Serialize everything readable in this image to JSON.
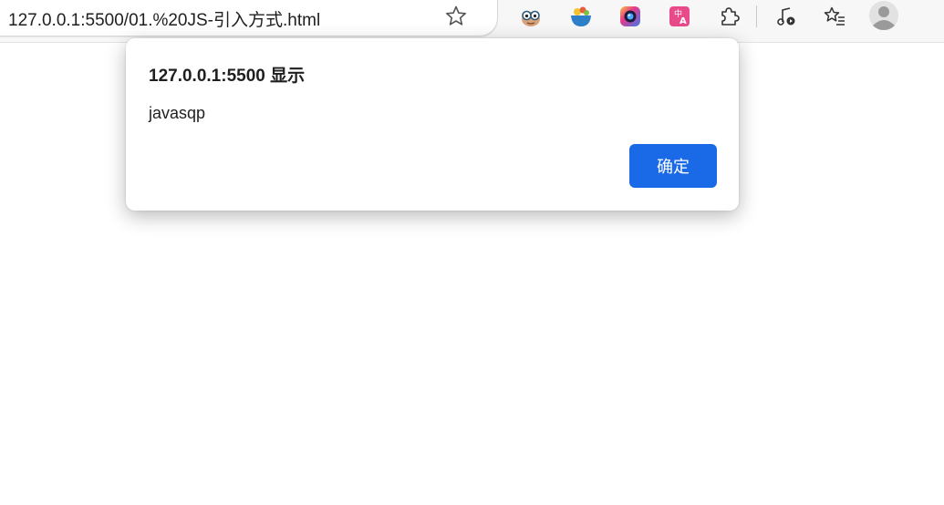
{
  "browser": {
    "url": "127.0.0.1:5500/01.%20JS-引入方式.html",
    "icons": [
      "favorite-star-icon",
      "extension-eyes-icon",
      "extension-bowl-icon",
      "extension-camera-icon",
      "translate-icon",
      "extensions-puzzle-icon",
      "media-music-icon",
      "favorites-list-icon",
      "profile-avatar-icon"
    ]
  },
  "dialog": {
    "title": "127.0.0.1:5500 显示",
    "message": "javasqp",
    "ok_label": "确定",
    "accent_color": "#1a6ae8"
  }
}
